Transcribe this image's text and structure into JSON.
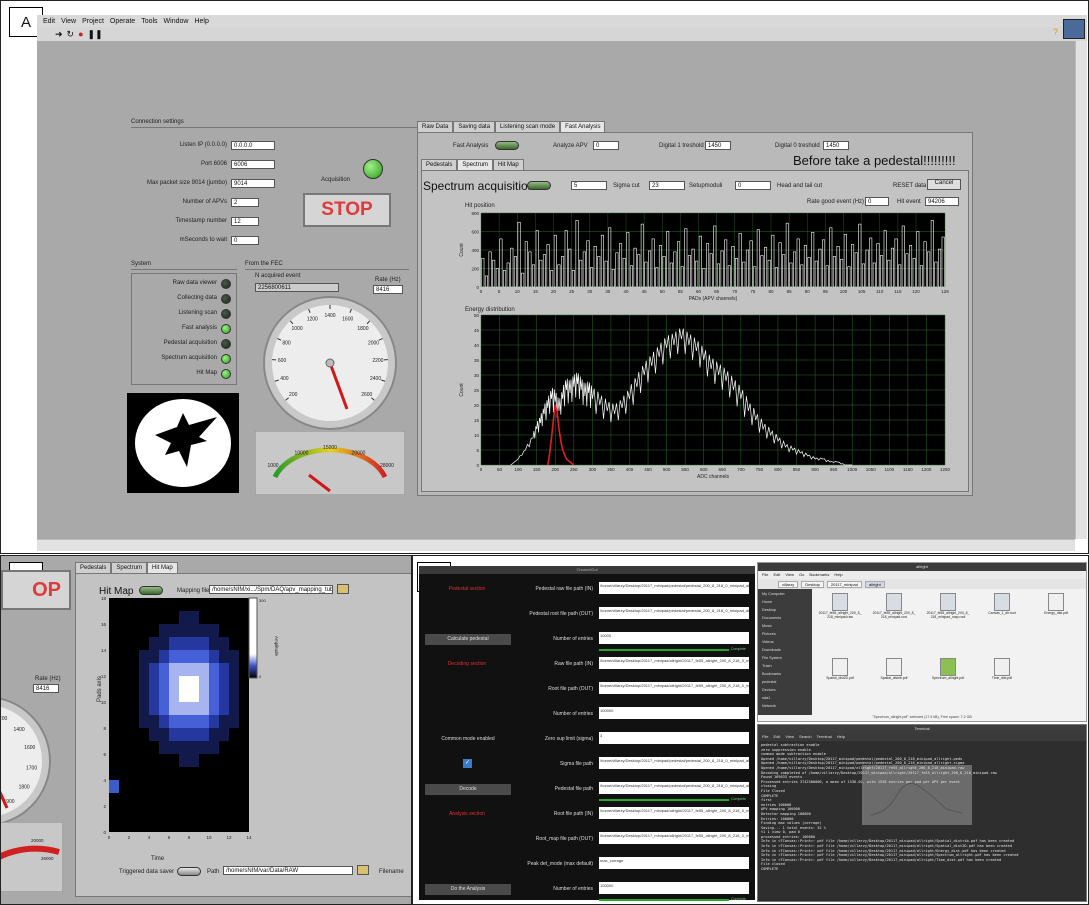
{
  "panel_labels": {
    "a": "A",
    "b": "B",
    "c": "C"
  },
  "labview": {
    "menu": [
      "Edit",
      "View",
      "Project",
      "Operate",
      "Tools",
      "Window",
      "Help"
    ],
    "connection": {
      "title": "Connection settings",
      "fields": [
        {
          "label": "Listen IP (0.0.0.0)",
          "value": "0.0.0.0"
        },
        {
          "label": "Port 6006",
          "value": "6006"
        },
        {
          "label": "Max packet size 9014 (jumbo)",
          "value": "9014"
        },
        {
          "label": "Number of APVs",
          "value": "2"
        },
        {
          "label": "Timestamp number",
          "value": "12"
        },
        {
          "label": "mSeconds to wait",
          "value": "0"
        }
      ],
      "acquisition_label": "Acquisition",
      "stop_label": "STOP"
    },
    "system": {
      "title": "System",
      "leds": [
        {
          "label": "Raw data viewer",
          "on": false
        },
        {
          "label": "Collecting data",
          "on": false
        },
        {
          "label": "Listening scan",
          "on": false
        },
        {
          "label": "Fast analysis",
          "on": true
        },
        {
          "label": "Pedestal acquisition",
          "on": false
        },
        {
          "label": "Spectrum acquisition",
          "on": true
        },
        {
          "label": "Hit Map",
          "on": true
        }
      ]
    },
    "from_fec": {
      "title": "From the FEC",
      "acq_label": "N acquired event",
      "acq_value": "2256800611",
      "rate_label": "Rate (Hz)",
      "rate_value": "8416",
      "gauge_ticks": [
        "200",
        "400",
        "600",
        "800",
        "1000",
        "1200",
        "1400",
        "1600",
        "1800",
        "2000",
        "2200",
        "2400",
        "2600"
      ],
      "meter_ticks": [
        "1000",
        "10000",
        "15000",
        "20000",
        "28000"
      ]
    },
    "tabs": [
      "Raw Data",
      "Saving data",
      "Listening scan mode",
      "Fast Analysis"
    ],
    "fast": {
      "fast_analysis_label": "Fast Analysis",
      "analyze_apv_label": "Analyze APV",
      "analyze_apv_value": "0",
      "d1_label": "Digital 1 treshold",
      "d1_value": "1450",
      "d0_label": "Digital 0 treshold",
      "d0_value": "1450",
      "banner": "Before take a pedestal!!!!!!!!!",
      "subtabs": [
        "Pedestals",
        "Spectrum",
        "Hit Map"
      ],
      "spectrum_label": "Spectrum acquisition",
      "sigma_value": "5",
      "sigma_label": "Sigma cut",
      "setup_value": "23",
      "setup_label": "Setupmoduli",
      "head_value": "0",
      "head_label": "Head and tail cut",
      "reset_label": "RESET data",
      "cancel_label": "Cancel",
      "rate_good_label": "Rate good event (Hz)",
      "rate_good_value": "0",
      "hit_label": "Hit event",
      "hit_value": "94206",
      "hit_pos_title": "Hit position",
      "energy_title": "Energy distribution"
    }
  },
  "panel_b": {
    "subtabs": [
      "Pedestals",
      "Spectrum",
      "Hit Map"
    ],
    "hit_map_label": "Hit Map",
    "mapping_label": "Mapping file",
    "mapping_path": "/home/sNIM/xi.../Spm/DAQ/apv_mapping_tub.txt",
    "stop_label": "OP",
    "rate_label": "Rate (Hz)",
    "rate_value": "8416",
    "gauge_ticks": [
      "1200",
      "1400",
      "1600",
      "1700",
      "1800",
      "1900"
    ],
    "meter_ticks": [
      "20000",
      "26000"
    ],
    "y_axis_label": "Pads axis",
    "x_axis_label": "Time",
    "colorbar_label": "Amplitude",
    "x_ticks": [
      "0",
      "2",
      "4",
      "6",
      "8",
      "10",
      "12",
      "14"
    ],
    "y_ticks": [
      "0",
      "2",
      "4",
      "6",
      "8",
      "10",
      "12",
      "14",
      "16",
      "18"
    ],
    "triggered_label": "Triggered data saver",
    "path_label": "Path",
    "path_value": "/home/sNIM/var/Data/RAW",
    "filename_label": "Filename",
    "colorbar_ticks": [
      "0",
      "300"
    ]
  },
  "panel_c": {
    "gui": {
      "title": "ChannelGui",
      "rows": [
        {
          "left": "Pedestal section",
          "leftType": "red",
          "label": "Pedestal raw file path (IN)",
          "value": "/home/villarzy/Desktop/20117_minipad/pedestal/pedestal_200_8_218_0_minipad_allright.raw"
        },
        {
          "left": "",
          "leftType": "none",
          "label": "Pedestal root file path (OUT)",
          "value": "/home/villarzy/Desktop/20117_minipad/pedestal/pedestal_200_8_218_0_minipad_allright.root"
        },
        {
          "left": "Calculate pedestal",
          "leftType": "btn",
          "label": "Number of entries",
          "value": "10000"
        },
        {
          "left": "Decoding section",
          "leftType": "red",
          "label": "Raw file path (IN)",
          "value": "/home/villarzy/Desktop/20117_minipad/allright/20117_fe55_allright_200_8_218_0_minipad.raw"
        },
        {
          "left": "",
          "leftType": "none",
          "label": "Root file path (OUT)",
          "value": "/home/villarzy/Desktop/20117_minipad/allright/20117_fe55_allright_200_8_218_0_minipad.root"
        },
        {
          "left": "",
          "leftType": "none",
          "label": "Number of entries",
          "value": "100000"
        },
        {
          "left": "Common mode enabled",
          "leftType": "text",
          "label": "Zero sup limit (sigma)",
          "value": "3"
        },
        {
          "left": "✓",
          "leftType": "check",
          "label": "Sigma file path",
          "value": "/home/villarzy/Desktop/20117_minipad/pedestal/pedestal_200_8_218_0_minipad_allright.sigma"
        },
        {
          "left": "Decode",
          "leftType": "btn",
          "label": "Pedestal file path",
          "value": "/home/villarzy/Desktop/20117_minipad/pedestal/pedestal_200_8_218_0_minipad_allright.root"
        },
        {
          "left": "Analysis section",
          "leftType": "red",
          "label": "Root file path (IN)",
          "value": "/home/villarzy/Desktop/20117_minipad/allright/20117_fe55_allright_200_8_218_0_minipad.root"
        },
        {
          "left": "",
          "leftType": "none",
          "label": "Root_map file path (OUT)",
          "value": "/home/villarzy/Desktop/20117_minipad/allright/20117_fe55_allright_200_8_218_0_minipad_map.root"
        },
        {
          "left": "",
          "leftType": "none",
          "label": "Peak det_mode (max default)",
          "value": "max_corrage"
        },
        {
          "left": "Do the Analysis",
          "leftType": "btn",
          "label": "Number of entries",
          "value": "100000"
        }
      ],
      "complete_labels": [
        "Complete",
        "Complete",
        "Complete"
      ]
    },
    "files": {
      "title": "allright",
      "menu": [
        "File",
        "Edit",
        "View",
        "Go",
        "Bookmarks",
        "Help"
      ],
      "breadcrumb": [
        "villarzy",
        "Desktop",
        "20117_minipad",
        "allright"
      ],
      "sidebar": [
        "My Computer",
        "Home",
        "Desktop",
        "Documents",
        "Music",
        "Pictures",
        "Videos",
        "Downloads",
        "File System",
        "Trash",
        "Bookmarks",
        "pedestal",
        "Devices",
        "sda1",
        "Network"
      ],
      "items": [
        "20117_fe55_allright_200_8_218_minipad.raw",
        "20117_fe55_allright_200_8_218_minipad.root",
        "20117_fe55_allright_200_8_218_minipad_map.root",
        "Canvas_1_dir.root",
        "Energy_dist.pdf",
        "Spatial_dist2D.pdf",
        "Spatial_distrib.pdf",
        "Spectrum_allright.pdf",
        "Time_dist.pdf"
      ],
      "status": "\"Spectrum_allright.pdf\" selected (17.5 kB), Free space: 7.2 GB"
    },
    "terminal": {
      "title": "Terminal",
      "menu": [
        "File",
        "Edit",
        "View",
        "Search",
        "Terminal",
        "Help"
      ],
      "lines": [
        "pedestal subtraction enable",
        "zero suppression enable",
        "common mode subtraction enable",
        "Opened /home/villarzy/Desktop/20117_minipad/pedestal/pedestal_200_8_218_minipad_allright.peds",
        "Opened /home/villarzy/Desktop/20117_minipad/pedestal/pedestal_200_8_218_minipad_allright.sigma",
        "Opened /home/villarzy/Desktop/20117_minipad/allright/20117_fe55_allright_200_8_218_minipad.raw",
        "Decoding completed of /home/villarzy/Desktop/20117_minipad/allright/20117_fe55_allright_200_8_218_minipad.raw",
        "Found 169033 events",
        "Processed entries 3742500000, a mean of 1536.02, with 1536 entries per pad per APV per event",
        "closing",
        "File Closed",
        "COMPLETE",
        "first",
        "entries 100000",
        "APV mapping 100000",
        "Detector mapping 100000",
        "Entries: 100000",
        "Finding max values (corrage)",
        "Saving...  1 total events: 32 %",
        "t1 1 view 0, pad 0",
        "processed entries: 100000",
        "Info in <TCanvas::Print>: pdf file /home/villarzy/Desktop/20117_minipad/allright/Spatial_distrib.pdf has been created",
        "Info in <TCanvas::Print>: pdf file /home/villarzy/Desktop/20117_minipad/allright/Spatial_dist2D.pdf has been created",
        "Info in <TCanvas::Print>: pdf file /home/villarzy/Desktop/20117_minipad/allright/Energy_dist.pdf has been created",
        "Info in <TCanvas::Print>: pdf file /home/villarzy/Desktop/20117_minipad/allright/Spectrum_allright.pdf has been created",
        "Info in <TCanvas::Print>: pdf file /home/villarzy/Desktop/20117_minipad/allright/Time_dist.pdf has been created",
        "File closed",
        "COMPLETE"
      ]
    }
  },
  "chart_data": [
    {
      "type": "bar",
      "title": "Hit position",
      "xlabel": "PADs (APV channels)",
      "ylabel": "Count",
      "xlim": [
        0,
        128
      ],
      "ylim": [
        0,
        800
      ],
      "y_ticks": [
        "0",
        "200",
        "400",
        "600",
        "800"
      ],
      "x_ticks": [
        "0",
        "5",
        "10",
        "15",
        "20",
        "25",
        "30",
        "35",
        "40",
        "45",
        "50",
        "55",
        "60",
        "65",
        "70",
        "75",
        "80",
        "85",
        "90",
        "95",
        "100",
        "105",
        "110",
        "115",
        "120",
        "128"
      ],
      "values": [
        310,
        120,
        380,
        290,
        200,
        520,
        180,
        260,
        420,
        330,
        700,
        150,
        490,
        380,
        240,
        610,
        290,
        350,
        460,
        180,
        560,
        240,
        330,
        610,
        410,
        180,
        720,
        290,
        380,
        500,
        210,
        440,
        330,
        560,
        280,
        640,
        190,
        370,
        470,
        310,
        590,
        230,
        420,
        350,
        680,
        270,
        390,
        520,
        210,
        450,
        330,
        600,
        260,
        380,
        490,
        220,
        630,
        340,
        410,
        280,
        550,
        200,
        470,
        360,
        660,
        250,
        390,
        510,
        230,
        440,
        310,
        580,
        270,
        400,
        500,
        220,
        620,
        340,
        430,
        290,
        560,
        210,
        480,
        350,
        690,
        260,
        380,
        520,
        240,
        450,
        320,
        590,
        280,
        410,
        510,
        230,
        640,
        330,
        440,
        300,
        570,
        220,
        460,
        370,
        680,
        250,
        400,
        530,
        260,
        470,
        340,
        610,
        290,
        420,
        520,
        240,
        660,
        360,
        450,
        310,
        600,
        230,
        490,
        380,
        720,
        270,
        410,
        540
      ]
    },
    {
      "type": "line",
      "title": "Energy distribution",
      "xlabel": "ADC channels",
      "ylabel": "Count",
      "xlim": [
        0,
        1250
      ],
      "ylim": [
        0,
        50
      ],
      "y_ticks": [
        "0",
        "5",
        "10",
        "15",
        "20",
        "25",
        "30",
        "35",
        "40",
        "45",
        "50"
      ],
      "x_ticks": [
        "0",
        "50",
        "100",
        "150",
        "200",
        "250",
        "300",
        "350",
        "400",
        "450",
        "500",
        "550",
        "600",
        "650",
        "700",
        "750",
        "800",
        "850",
        "900",
        "950",
        "1000",
        "1050",
        "1100",
        "1150",
        "1200",
        "1250"
      ],
      "series": [
        {
          "color": "#ffffff",
          "x": [
            80,
            100,
            120,
            140,
            150,
            160,
            170,
            180,
            190,
            200,
            210,
            220,
            230,
            240,
            250,
            260,
            270,
            280,
            290,
            300,
            320,
            340,
            360,
            380,
            400,
            420,
            440,
            460,
            480,
            500,
            520,
            540,
            560,
            580,
            600,
            620,
            640,
            660,
            680,
            700,
            720,
            740,
            760,
            780,
            800,
            820,
            840,
            860,
            880,
            900,
            920,
            940,
            960,
            980,
            1000
          ],
          "y": [
            0,
            2,
            5,
            9,
            12,
            14,
            17,
            19,
            22,
            21,
            18,
            22,
            25,
            24,
            26,
            27,
            25,
            23,
            24,
            22,
            20,
            18,
            17,
            19,
            22,
            26,
            30,
            33,
            36,
            39,
            40,
            42,
            40,
            38,
            35,
            32,
            30,
            28,
            25,
            22,
            18,
            15,
            12,
            10,
            8,
            6,
            5,
            4,
            3,
            2,
            2,
            1,
            1,
            0,
            0
          ]
        },
        {
          "color": "#e02020",
          "x": [
            180,
            185,
            190,
            195,
            200,
            205,
            210,
            215,
            220,
            230,
            240,
            250
          ],
          "y": [
            0,
            4,
            9,
            15,
            20,
            18,
            12,
            8,
            5,
            2,
            1,
            0
          ]
        }
      ]
    }
  ]
}
